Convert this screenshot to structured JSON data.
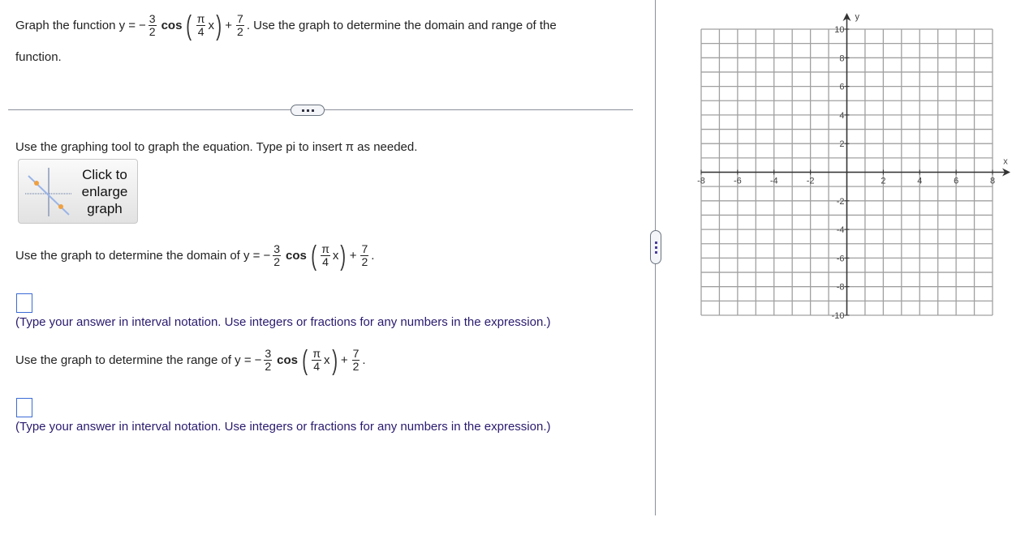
{
  "question": {
    "prefix": "Graph the function y =",
    "neg": "−",
    "a_num": "3",
    "a_den": "2",
    "cos": "cos",
    "b_num": "π",
    "b_den": "4",
    "var": "x",
    "plus": "+",
    "c_num": "7",
    "c_den": "2",
    "suffix": ". Use the graph to determine the domain and range of the",
    "line2": "function."
  },
  "instruction": "Use the graphing tool to graph the equation. Type pi to insert π as needed.",
  "enlarge_button": {
    "label": "Click to enlarge graph",
    "icon": "graph-thumbnail-icon"
  },
  "domain_part": {
    "prompt": "Use the graph to determine the domain of y =",
    "answer": "",
    "hint": "(Type your answer in interval notation. Use integers or fractions for any numbers in the expression.)"
  },
  "range_part": {
    "prompt": "Use the graph to determine the range of y =",
    "answer": "",
    "hint": "(Type your answer in interval notation. Use integers or fractions for any numbers in the expression.)"
  },
  "chart_data": {
    "type": "scatter",
    "series": [],
    "xlabel": "x",
    "ylabel": "y",
    "xlim": [
      -8,
      8
    ],
    "ylim": [
      -10,
      10
    ],
    "xticks": [
      -8,
      -6,
      -4,
      -2,
      2,
      4,
      6,
      8
    ],
    "yticks": [
      -10,
      -8,
      -6,
      -4,
      -2,
      2,
      4,
      6,
      8,
      10
    ],
    "grid": true,
    "grid_step_x": 1,
    "grid_step_y": 1
  },
  "colors": {
    "grid": "#a0a0a0",
    "axis": "#333333",
    "answer_border": "#3b6bd6",
    "hint_text": "#2a1a6e"
  }
}
